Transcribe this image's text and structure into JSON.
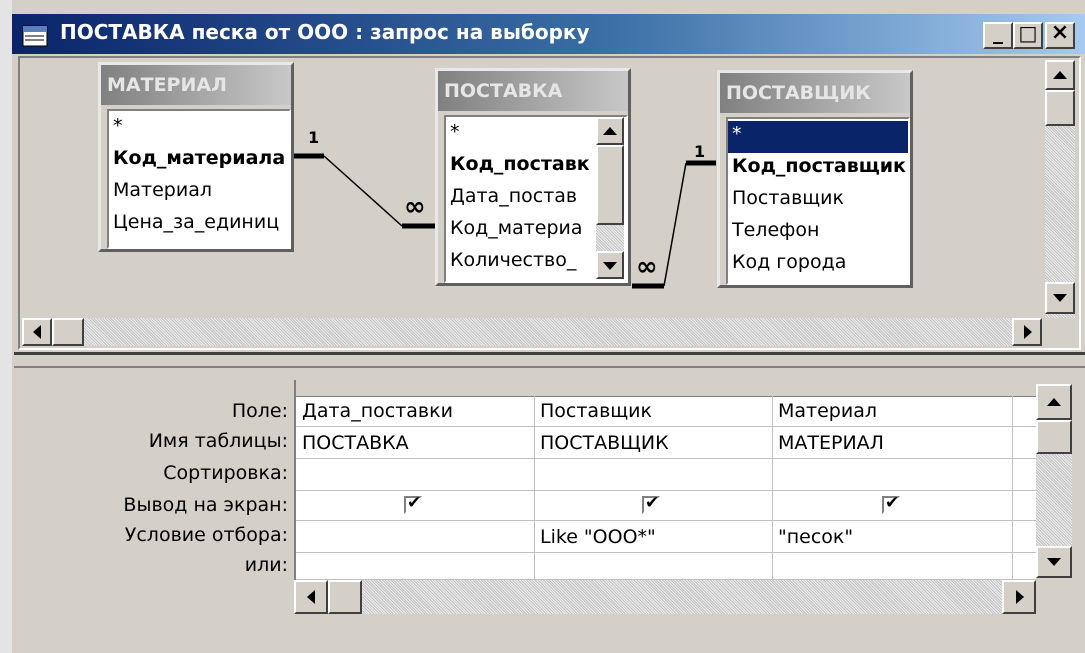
{
  "window": {
    "title": "ПОСТАВКА  песка от ООО : запрос на выборку",
    "controls": {
      "minimize": "_",
      "maximize": "□",
      "close": "×"
    }
  },
  "tables": [
    {
      "title": "МАТЕРИАЛ",
      "fields": [
        "*",
        "Код_материала",
        "Материал",
        "Цена_за_единиц"
      ]
    },
    {
      "title": "ПОСТАВКА",
      "fields": [
        "*",
        "Код_поставк",
        "Дата_постав",
        "Код_материа",
        "Количество_"
      ]
    },
    {
      "title": "ПОСТАВЩИК",
      "fields": [
        "*",
        "Код_поставщик",
        "Поставщик",
        "Телефон",
        "Код города"
      ]
    }
  ],
  "relations": [
    {
      "from": "МАТЕРИАЛ",
      "to": "ПОСТАВКА",
      "one": "1",
      "many": "∞"
    },
    {
      "from": "ПОСТАВЩИК",
      "to": "ПОСТАВКА",
      "one": "1",
      "many": "∞"
    }
  ],
  "grid": {
    "row_labels": [
      "Поле:",
      "Имя таблицы:",
      "Сортировка:",
      "Вывод на экран:",
      "Условие отбора:",
      "или:"
    ],
    "columns": [
      {
        "field": "Дата_поставки",
        "table": "ПОСТАВКА",
        "sort": "",
        "show": true,
        "criteria": "",
        "or": ""
      },
      {
        "field": "Поставщик",
        "table": "ПОСТАВЩИК",
        "sort": "",
        "show": true,
        "criteria": "Like \"ООО*\"",
        "or": ""
      },
      {
        "field": "Материал",
        "table": "МАТЕРИАЛ",
        "sort": "",
        "show": true,
        "criteria": "\"песок\"",
        "or": ""
      }
    ]
  },
  "colors": {
    "title_start": "#0a246a",
    "title_end": "#a6caf0",
    "face": "#d4d0c8",
    "selection": "#0a246a"
  }
}
